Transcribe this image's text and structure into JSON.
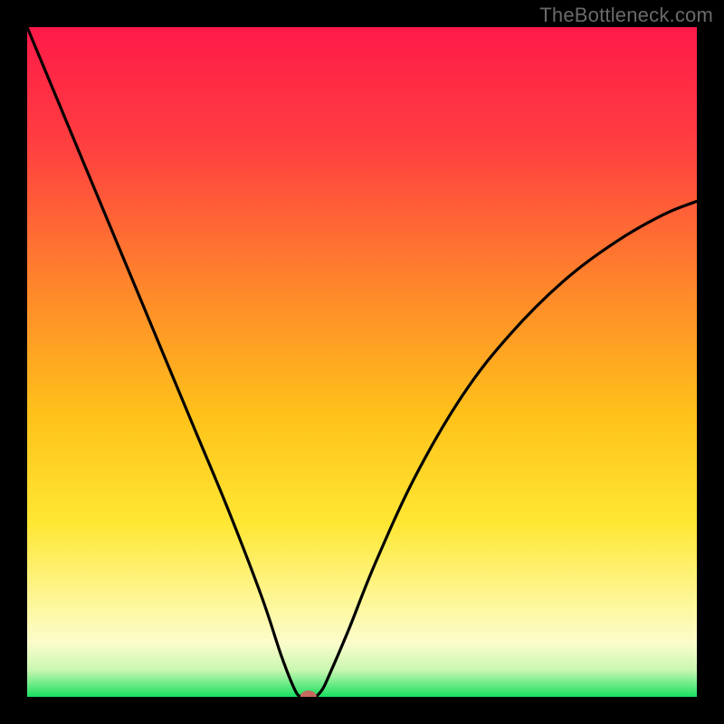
{
  "watermark": "TheBottleneck.com",
  "chart_data": {
    "type": "line",
    "title": "",
    "xlabel": "",
    "ylabel": "",
    "xlim": [
      0,
      100
    ],
    "ylim": [
      0,
      100
    ],
    "grid": false,
    "legend": false,
    "gradient_stops": [
      {
        "offset": 0,
        "color": "#ff1a49"
      },
      {
        "offset": 18,
        "color": "#ff4040"
      },
      {
        "offset": 40,
        "color": "#ff8a2a"
      },
      {
        "offset": 58,
        "color": "#ffc21a"
      },
      {
        "offset": 74,
        "color": "#ffe733"
      },
      {
        "offset": 86,
        "color": "#fdf79a"
      },
      {
        "offset": 92,
        "color": "#fbfccb"
      },
      {
        "offset": 96,
        "color": "#c9f7b0"
      },
      {
        "offset": 100,
        "color": "#18e060"
      }
    ],
    "series": [
      {
        "name": "bottleneck-curve",
        "x": [
          0,
          5,
          10,
          15,
          20,
          25,
          30,
          35,
          38,
          40,
          41,
          42,
          43,
          44,
          45,
          48,
          52,
          58,
          65,
          72,
          80,
          88,
          95,
          100
        ],
        "y": [
          100,
          88,
          76,
          64,
          52,
          40,
          28,
          15,
          6,
          1,
          0,
          0,
          0,
          1,
          3,
          10,
          20,
          33,
          45,
          54,
          62,
          68,
          72,
          74
        ]
      }
    ],
    "flat_bottom": {
      "x_start": 39,
      "x_end": 44,
      "y": 0
    },
    "marker": {
      "x": 42,
      "y": 0,
      "color": "#c66a5f",
      "rx": 9,
      "ry": 7
    }
  }
}
